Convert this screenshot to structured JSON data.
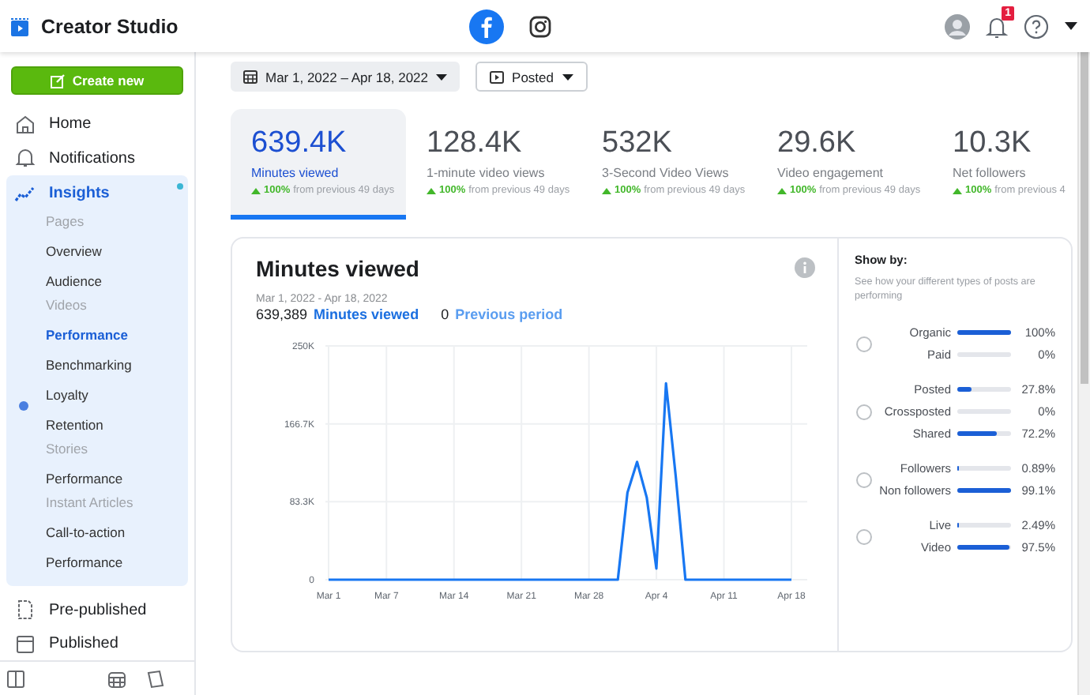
{
  "topbar": {
    "app_title": "Creator Studio",
    "platforms": [
      {
        "selected": true
      },
      {
        "selected": false
      }
    ],
    "notification_count": "1"
  },
  "sidebar": {
    "create_button": "Create new",
    "items": [
      {
        "label": "Home",
        "selected": false,
        "dot": false
      },
      {
        "label": "Notifications",
        "selected": false,
        "dot": false
      },
      {
        "label": "Insights",
        "selected": true,
        "dot": true,
        "children": [
          {
            "kind": "header",
            "label": "Pages"
          },
          {
            "kind": "link",
            "label": "Overview",
            "selected": false,
            "dot": false
          },
          {
            "kind": "link",
            "label": "Audience",
            "selected": false,
            "dot": false
          },
          {
            "kind": "header",
            "label": "Videos"
          },
          {
            "kind": "link",
            "label": "Performance",
            "selected": true,
            "dot": false
          },
          {
            "kind": "link",
            "label": "Benchmarking",
            "selected": false,
            "dot": false
          },
          {
            "kind": "link",
            "label": "Loyalty",
            "selected": false,
            "dot": true
          },
          {
            "kind": "link",
            "label": "Retention",
            "selected": false,
            "dot": false
          },
          {
            "kind": "header",
            "label": "Stories"
          },
          {
            "kind": "link",
            "label": "Performance",
            "selected": false,
            "dot": false
          },
          {
            "kind": "header",
            "label": "Instant Articles"
          },
          {
            "kind": "link",
            "label": "Call-to-action",
            "selected": false,
            "dot": false
          },
          {
            "kind": "link",
            "label": "Performance",
            "selected": false,
            "dot": false
          }
        ]
      },
      {
        "label": "Pre-published",
        "selected": false,
        "dot": false
      },
      {
        "label": "Published",
        "selected": false,
        "dot": false
      }
    ]
  },
  "filters": {
    "date_range": "Mar 1, 2022 – Apr 18, 2022",
    "post_filter": "Posted"
  },
  "stats": [
    {
      "value": "639.4K",
      "label": "Minutes viewed",
      "change": "100%",
      "change_text": "from previous 49 days",
      "selected": true
    },
    {
      "value": "128.4K",
      "label": "1-minute video views",
      "change": "100%",
      "change_text": "from previous 49 days",
      "selected": false
    },
    {
      "value": "532K",
      "label": "3-Second Video Views",
      "change": "100%",
      "change_text": "from previous 49 days",
      "selected": false
    },
    {
      "value": "29.6K",
      "label": "Video engagement",
      "change": "100%",
      "change_text": "from previous 49 days",
      "selected": false
    },
    {
      "value": "10.3K",
      "label": "Net followers",
      "change": "100%",
      "change_text": "from previous 4",
      "selected": false
    }
  ],
  "chart": {
    "title": "Minutes viewed",
    "date_range": "Mar 1, 2022 - Apr 18, 2022",
    "total": "639,389",
    "previous": "0",
    "previous_label": "Previous period",
    "chart_data": {
      "type": "line",
      "categories": [
        "Mar 1",
        null,
        null,
        null,
        null,
        null,
        "Mar 7",
        null,
        null,
        null,
        null,
        null,
        null,
        "Mar 14",
        null,
        null,
        null,
        null,
        null,
        null,
        "Mar 21",
        null,
        null,
        null,
        null,
        null,
        null,
        "Mar 28",
        null,
        null,
        null,
        null,
        null,
        null,
        "Apr 4",
        null,
        null,
        null,
        null,
        null,
        null,
        "Apr 11",
        null,
        null,
        null,
        null,
        null,
        null,
        "Apr 18"
      ],
      "ylim": [
        0,
        250000
      ],
      "grid": true,
      "yticks": [
        {
          "value": 0,
          "label": "0"
        },
        {
          "value": 83333,
          "label": "83.3K"
        },
        {
          "value": 166667,
          "label": "166.7K"
        },
        {
          "value": 250000,
          "label": "250K"
        }
      ],
      "series": [
        {
          "name": "Minutes viewed",
          "color": "#1877f2",
          "values": [
            0,
            0,
            0,
            0,
            0,
            0,
            0,
            0,
            0,
            0,
            0,
            0,
            0,
            0,
            0,
            0,
            0,
            0,
            0,
            0,
            0,
            0,
            0,
            0,
            0,
            0,
            0,
            0,
            0,
            0,
            0,
            93000,
            126000,
            88000,
            12000,
            210000,
            110000,
            0,
            0,
            0,
            0,
            0,
            0,
            0,
            0,
            0,
            0,
            0,
            0
          ]
        }
      ]
    }
  },
  "show_by": {
    "title": "Show by:",
    "description": "See how your different types of posts are performing",
    "groups": [
      {
        "selected": false,
        "rows": [
          {
            "label": "Organic",
            "level": 1,
            "value": "100%"
          },
          {
            "label": "Paid",
            "level": 0,
            "value": "0%"
          }
        ]
      },
      {
        "selected": false,
        "rows": [
          {
            "label": "Posted",
            "level": 0.278,
            "value": "27.8%"
          },
          {
            "label": "Crossposted",
            "level": 0,
            "value": "0%"
          },
          {
            "label": "Shared",
            "level": 0.722,
            "value": "72.2%"
          }
        ]
      },
      {
        "selected": false,
        "rows": [
          {
            "label": "Followers",
            "level": 0.0089,
            "value": "0.89%"
          },
          {
            "label": "Non followers",
            "level": 0.991,
            "value": "99.1%"
          }
        ]
      },
      {
        "selected": false,
        "rows": [
          {
            "label": "Live",
            "level": 0.0249,
            "value": "2.49%"
          },
          {
            "label": "Video",
            "level": 0.975,
            "value": "97.5%"
          }
        ]
      }
    ]
  }
}
